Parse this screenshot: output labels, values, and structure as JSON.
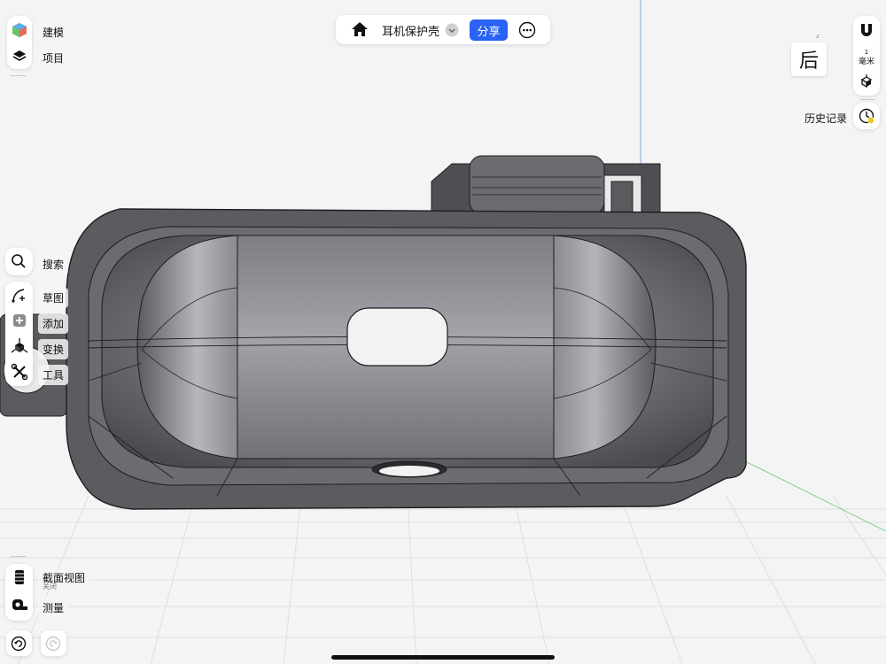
{
  "app": {
    "project_title": "耳机保护壳",
    "share_label": "分享"
  },
  "left_toolbar": {
    "top": [
      {
        "id": "modeling",
        "label": "建模",
        "icon": "cube-icon"
      },
      {
        "id": "project",
        "label": "项目",
        "icon": "layers-icon"
      }
    ],
    "search": {
      "label": "搜索",
      "icon": "search-icon"
    },
    "tools": [
      {
        "id": "sketch",
        "label": "草图",
        "icon": "sketch-icon"
      },
      {
        "id": "add",
        "label": "添加",
        "icon": "add-icon"
      },
      {
        "id": "transform",
        "label": "变换",
        "icon": "transform-icon"
      },
      {
        "id": "tools",
        "label": "工具",
        "icon": "wrench-icon"
      }
    ],
    "bottom": [
      {
        "id": "section-view",
        "label": "截面视图",
        "sublabel": "关闭",
        "icon": "section-view-icon"
      },
      {
        "id": "measure",
        "label": "测量",
        "icon": "tape-measure-icon"
      }
    ]
  },
  "right_toolbar": {
    "unit_top": "1",
    "unit_label": "毫米",
    "history_label": "历史记录",
    "view_cube_label": "后"
  },
  "colors": {
    "accent": "#2a62f5",
    "model_gray": "#5b5c60",
    "background": "#f4f4f4"
  }
}
